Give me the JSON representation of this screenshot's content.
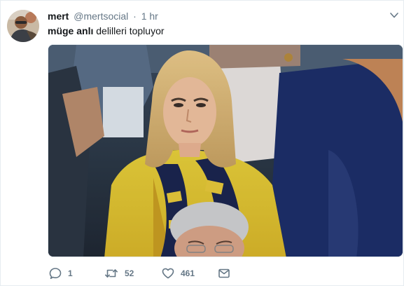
{
  "tweet": {
    "author_name": "mert",
    "handle": "@mertsocial",
    "separator": "·",
    "time": "1 hr",
    "text_bold": "müge anlı",
    "text_rest": " delilleri topluyor",
    "reply_count": "1",
    "retweet_count": "52",
    "like_count": "461"
  },
  "icons": {
    "caret": "chevron-down-icon",
    "reply": "speech-bubble-icon",
    "retweet": "retweet-icon",
    "like": "heart-icon",
    "direct_message": "envelope-icon"
  },
  "colors": {
    "primary_text": "#14171a",
    "secondary_text": "#657786",
    "border": "#e6ecf0"
  }
}
